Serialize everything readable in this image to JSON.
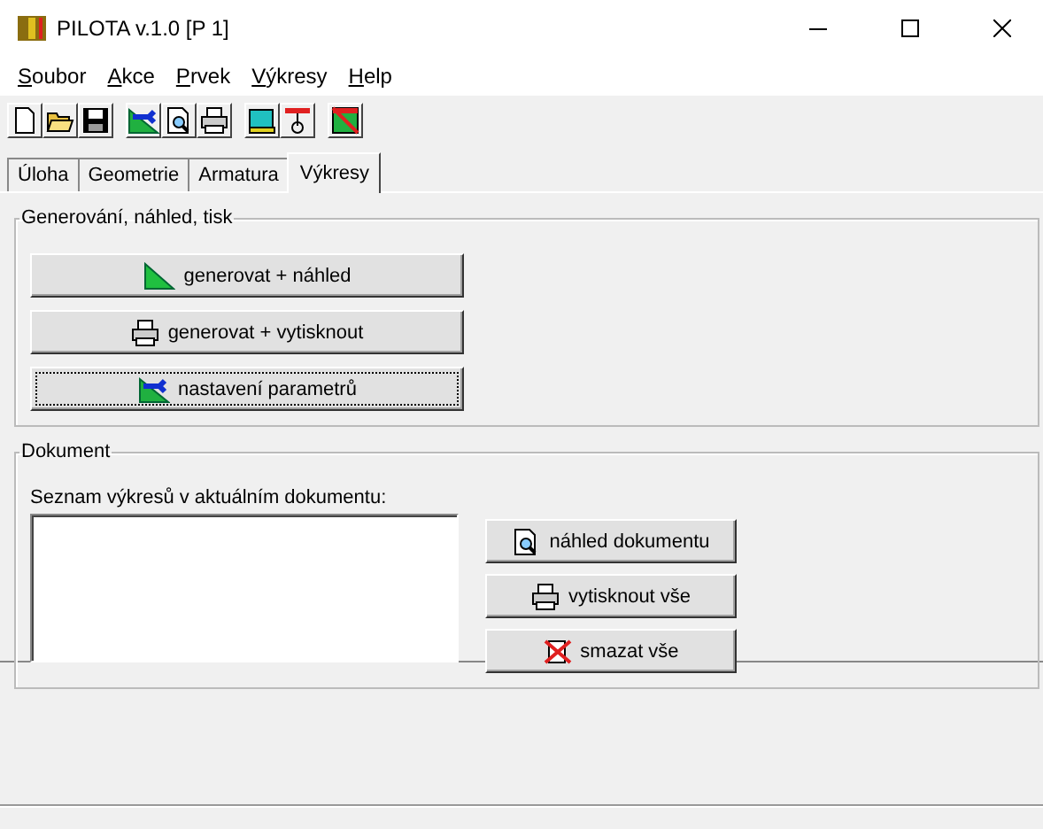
{
  "window": {
    "title": "PILOTA v.1.0 [P 1]"
  },
  "menu": [
    {
      "label": "Soubor"
    },
    {
      "label": "Akce"
    },
    {
      "label": "Prvek"
    },
    {
      "label": "Výkresy"
    },
    {
      "label": "Help"
    }
  ],
  "toolbar": [
    [
      {
        "kind": "new"
      },
      {
        "kind": "open"
      },
      {
        "kind": "save"
      }
    ],
    [
      {
        "kind": "settings"
      },
      {
        "kind": "preview"
      },
      {
        "kind": "print"
      }
    ],
    [
      {
        "kind": "monitor"
      },
      {
        "kind": "pile"
      }
    ],
    [
      {
        "kind": "drawing"
      }
    ]
  ],
  "tabs": [
    {
      "label": "Úloha",
      "selected": false
    },
    {
      "label": "Geometrie",
      "selected": false
    },
    {
      "label": "Armatura",
      "selected": false
    },
    {
      "label": "Výkresy",
      "selected": true
    }
  ],
  "generate_group": {
    "title": "Generování, náhled, tisk",
    "buttons": [
      {
        "label": "generovat + náhled",
        "kind": "triangle",
        "focused": false
      },
      {
        "label": "generovat + vytisknout",
        "kind": "print",
        "focused": false
      },
      {
        "label": "nastavení parametrů",
        "kind": "settings",
        "focused": true
      }
    ]
  },
  "document_group": {
    "title": "Dokument",
    "list_label": "Seznam výkresů v aktuálním dokumentu:",
    "buttons": [
      {
        "label": "náhled dokumentu",
        "kind": "preview"
      },
      {
        "label": "vytisknout vše",
        "kind": "print"
      },
      {
        "label": "smazat vše",
        "kind": "delete"
      }
    ]
  }
}
